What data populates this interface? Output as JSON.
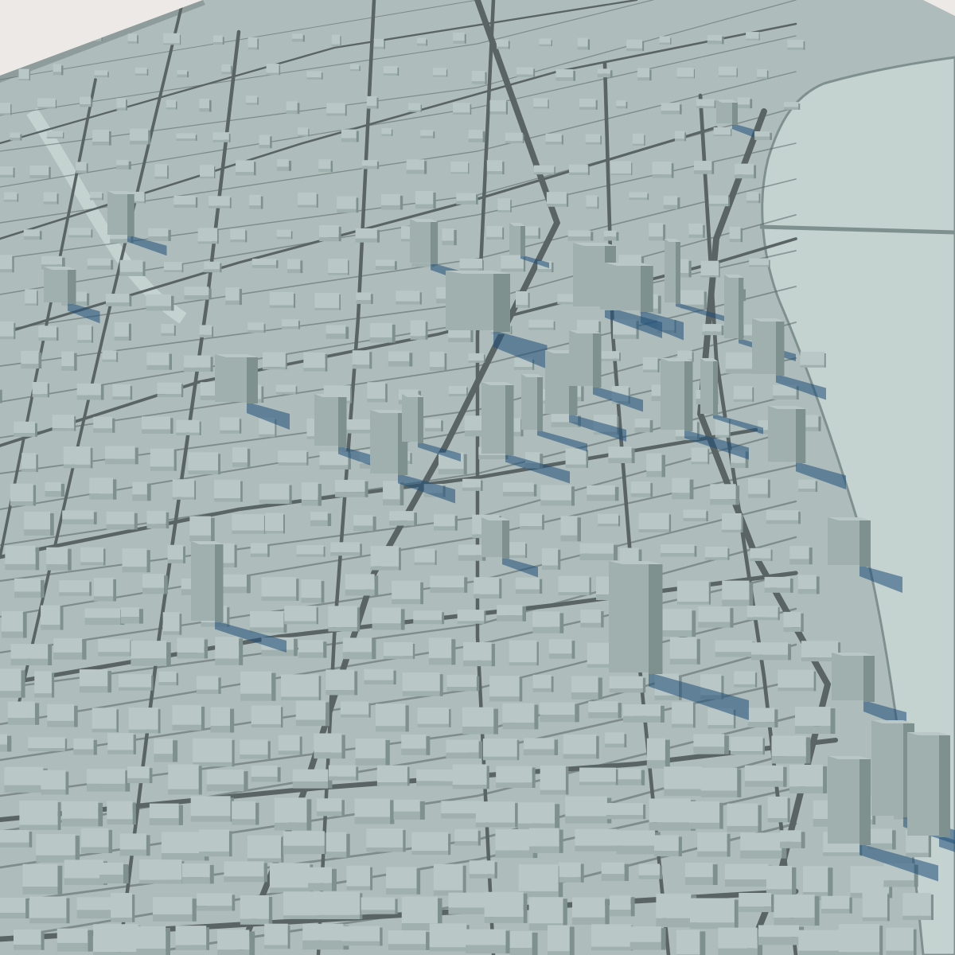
{
  "scene": {
    "subject": "3d-city-model-render",
    "style": "monochrome-clay",
    "palette": {
      "background": "#ece9e6",
      "ground": "#aebdbb",
      "street_line": "#5a6464",
      "block_top": "#b9c8c6",
      "block_side_light": "#9fb0ae",
      "block_side_dark": "#7f918f",
      "water": "#c4d2d0",
      "shadow": "#1f4f78"
    },
    "labels": []
  }
}
